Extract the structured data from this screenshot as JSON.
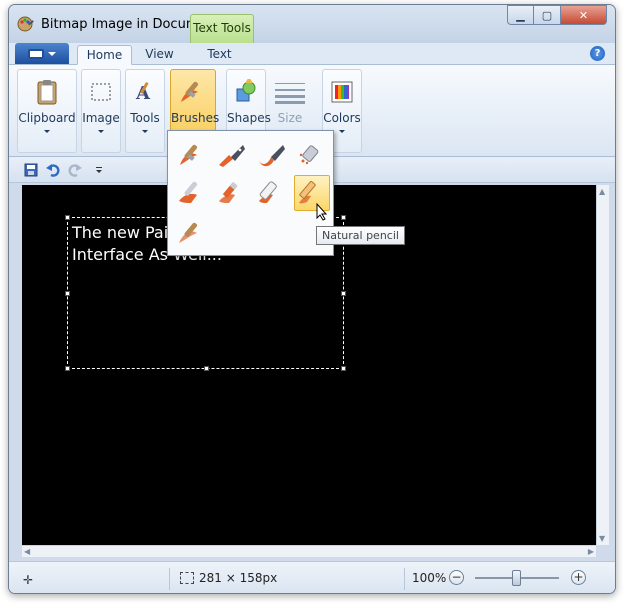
{
  "window": {
    "title": "Bitmap Image in Docume...",
    "context_tab": "Text Tools"
  },
  "tabs": [
    {
      "label": "Home",
      "active": true
    },
    {
      "label": "View",
      "active": false
    },
    {
      "label": "Text",
      "active": false
    }
  ],
  "help_label": "?",
  "ribbon": {
    "clipboard": "Clipboard",
    "image": "Image",
    "tools": "Tools",
    "brushes": "Brushes",
    "shapes": "Shapes",
    "size": "Size",
    "colors": "Colors"
  },
  "brushes_popup": {
    "items": [
      "Brush",
      "Calligraphy brush 1",
      "Calligraphy brush 2",
      "Airbrush",
      "Oil brush",
      "Crayon",
      "Marker",
      "Natural pencil",
      "Watercolor brush"
    ],
    "selected": "Natural pencil",
    "tooltip": "Natural pencil"
  },
  "canvas": {
    "text_line1": "The new Pai",
    "text_line2": "Interface As Well..."
  },
  "status": {
    "selection_size": "281 × 158px",
    "zoom": "100%",
    "zoom_level_fraction": 0.5
  },
  "colors": {
    "accent": "#1d4f9e",
    "active_group": "#f9c94e",
    "context_tab": "#b9e08e",
    "canvas": "#000000",
    "brush_orange": "#e2632c"
  }
}
